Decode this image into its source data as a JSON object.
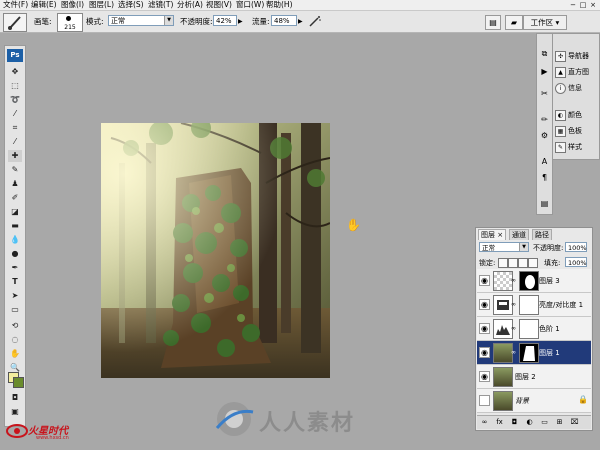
{
  "menu": {
    "items": [
      "文件(F)",
      "编辑(E)",
      "图像(I)",
      "图层(L)",
      "选择(S)",
      "滤镜(T)",
      "分析(A)",
      "视图(V)",
      "窗口(W)",
      "帮助(H)"
    ],
    "window_controls": [
      "−",
      "□",
      "×"
    ]
  },
  "options_bar": {
    "brush_label": "画笔:",
    "brush_size": "215",
    "mode_label": "模式:",
    "mode_value": "正常",
    "opacity_label": "不透明度:",
    "opacity_value": "42%",
    "flow_label": "流量:",
    "flow_value": "48%",
    "workspace_label": "工作区 ▾"
  },
  "toolbox": {
    "logo": "Ps",
    "tools": [
      "move-icon",
      "marquee-icon",
      "lasso-icon",
      "quick-select-icon",
      "crop-icon",
      "eyedropper-icon",
      "healing-icon",
      "brush-icon",
      "clone-stamp-icon",
      "history-brush-icon",
      "eraser-icon",
      "gradient-icon",
      "blur-icon",
      "dodge-icon",
      "pen-icon",
      "type-icon",
      "path-select-icon",
      "shape-icon",
      "3d-rotate-icon",
      "3d-orbit-icon",
      "hand-icon",
      "zoom-icon"
    ],
    "fg_color": "#f4ee9e",
    "bg_color": "#6a8c2c"
  },
  "dock": {
    "panels": [
      "导航器",
      "直方图",
      "信息",
      "颜色",
      "色板",
      "样式"
    ]
  },
  "layers_panel": {
    "tabs": [
      "图层 ×",
      "通道",
      "路径"
    ],
    "blend_mode": "正常",
    "opacity_label": "不透明度:",
    "opacity_value": "100%",
    "lock_label": "锁定:",
    "fill_label": "填充:",
    "fill_value": "100%",
    "layers": [
      {
        "name": "图层 3",
        "visible": true,
        "selected": false,
        "thumb": "transparent",
        "mask": "mask-white-blob"
      },
      {
        "name": "亮度/对比度 1",
        "visible": true,
        "selected": false,
        "thumb": "adjust-brightness",
        "mask": "mask-white"
      },
      {
        "name": "色阶 1",
        "visible": true,
        "selected": false,
        "thumb": "adjust-levels",
        "mask": "mask-white"
      },
      {
        "name": "图层 1",
        "visible": true,
        "selected": true,
        "thumb": "forest",
        "mask": "mask-white-blob"
      },
      {
        "name": "图层 2",
        "visible": true,
        "selected": false,
        "thumb": "forest",
        "mask": ""
      },
      {
        "name": "背景",
        "visible": false,
        "selected": false,
        "thumb": "forest",
        "mask": "",
        "locked": true
      }
    ],
    "footer_icons": [
      "link-icon",
      "fx-icon",
      "mask-icon",
      "adjustment-icon",
      "folder-icon",
      "new-layer-icon",
      "trash-icon"
    ]
  },
  "watermarks": {
    "left_brand": "火星时代",
    "left_url": "www.hxsd.cn",
    "center_text": "人人素材"
  },
  "colors": {
    "accent_selected": "#213a7a",
    "workspace_bg": "#a8a8a8"
  }
}
